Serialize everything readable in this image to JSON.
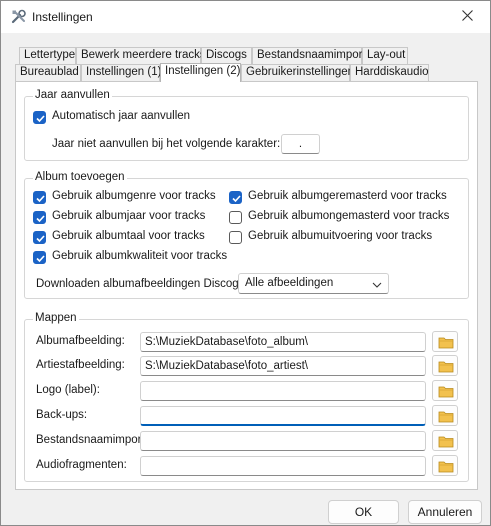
{
  "window": {
    "title": "Instellingen"
  },
  "tabs_row1": [
    "Lettertype",
    "Bewerk meerdere tracks",
    "Discogs",
    "Bestandsnaamimport",
    "Lay-out"
  ],
  "tabs_row2": [
    "Bureaublad",
    "Instellingen (1)",
    "Instellingen (2)",
    "Gebruikerinstellingen",
    "Harddiskaudio"
  ],
  "active_tab": "Instellingen (2)",
  "jaar": {
    "title": "Jaar aanvullen",
    "auto_label": "Automatisch jaar aanvullen",
    "auto_checked": true,
    "char_label": "Jaar niet aanvullen bij het volgende karakter:",
    "char_value": "."
  },
  "album": {
    "title": "Album toevoegen",
    "options": [
      {
        "label": "Gebruik albumgenre voor tracks",
        "checked": true
      },
      {
        "label": "Gebruik albumgeremasterd voor tracks",
        "checked": true
      },
      {
        "label": "Gebruik albumjaar voor tracks",
        "checked": true
      },
      {
        "label": "Gebruik albumongemasterd voor tracks",
        "checked": false
      },
      {
        "label": "Gebruik albumtaal voor tracks",
        "checked": true
      },
      {
        "label": "Gebruik albumuitvoering voor tracks",
        "checked": false
      },
      {
        "label": "Gebruik albumkwaliteit voor tracks",
        "checked": true
      }
    ],
    "download_label": "Downloaden albumafbeeldingen Discogs:",
    "download_value": "Alle afbeeldingen"
  },
  "mappen": {
    "title": "Mappen",
    "rows": [
      {
        "label": "Albumafbeelding:",
        "value": "S:\\MuziekDatabase\\foto_album\\"
      },
      {
        "label": "Artiestafbeelding:",
        "value": "S:\\MuziekDatabase\\foto_artiest\\"
      },
      {
        "label": "Logo (label):",
        "value": ""
      },
      {
        "label": "Back-ups:",
        "value": ""
      },
      {
        "label": "Bestandsnaamimport:",
        "value": ""
      },
      {
        "label": "Audiofragmenten:",
        "value": ""
      }
    ]
  },
  "buttons": {
    "ok": "OK",
    "cancel": "Annuleren"
  },
  "colors": {
    "accent": "#1b63c6",
    "folder": "#f2c14e"
  }
}
